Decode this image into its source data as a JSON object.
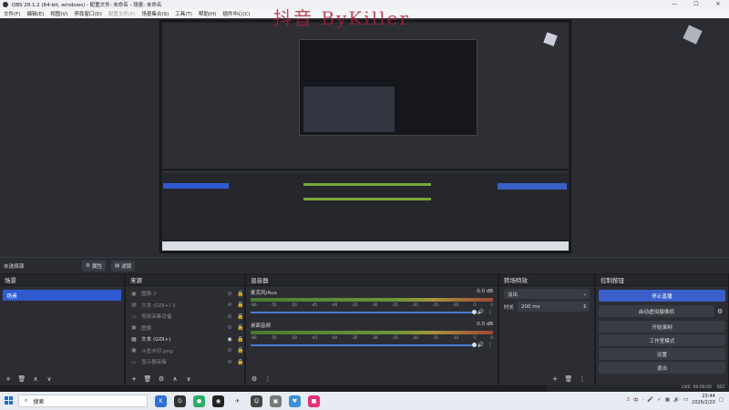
{
  "window": {
    "title": "OBS 28.1.2 (64-bit, windows) - 配置文件: 未命名 - 场景: 未命名",
    "controls": [
      "—",
      "☐",
      "✕"
    ]
  },
  "menu": [
    "文件(F)",
    "编辑(E)",
    "视图(V)",
    "停靠窗口(D)",
    "配置文件(P)",
    "场景集合(S)",
    "工具(T)",
    "帮助(H)",
    "插件中心(C)"
  ],
  "watermark": "抖音 ByKiller",
  "context": {
    "no_source": "未选择源",
    "properties": "属性",
    "filters": "滤镜"
  },
  "scenes": {
    "title": "场景",
    "items": [
      "场景"
    ]
  },
  "sources": {
    "title": "来源",
    "items": [
      {
        "name": "图像 2",
        "dim": true
      },
      {
        "name": "文本 (GDI+) 2",
        "dim": true
      },
      {
        "name": "视频采集设备",
        "dim": true
      },
      {
        "name": "图像",
        "dim": true
      },
      {
        "name": "文本 (GDI+)",
        "dim": false
      },
      {
        "name": "斗鱼水印.png",
        "dim": true
      },
      {
        "name": "显示器采集",
        "dim": true
      }
    ]
  },
  "mixer": {
    "title": "混音器",
    "channels": [
      {
        "name": "麦克风/Aux",
        "db": "0.0 dB"
      },
      {
        "name": "桌面音频",
        "db": "0.0 dB"
      }
    ],
    "ticks": [
      "-60",
      "-55",
      "-50",
      "-45",
      "-40",
      "-35",
      "-30",
      "-25",
      "-20",
      "-15",
      "-10",
      "-5",
      "0"
    ]
  },
  "transitions": {
    "title": "转场特效",
    "type": "淡出",
    "duration_label": "时长",
    "duration": "200 ms"
  },
  "controls": {
    "title": "控制按钮",
    "buttons": [
      "停止直播",
      "启动虚拟摄像机",
      "开始录制",
      "工作室模式",
      "设置",
      "退出"
    ]
  },
  "status": {
    "live": "LIVE: 00:00:00",
    "rec": "REC"
  },
  "taskbar": {
    "search": "搜索",
    "time": "23:44",
    "date": "2026/2/20",
    "tray": [
      "中",
      "·",
      "✓"
    ]
  },
  "colors": {
    "accent": "#2f5bd1",
    "primary_btn": "#3a5fc8",
    "bg": "#2b2d33"
  }
}
